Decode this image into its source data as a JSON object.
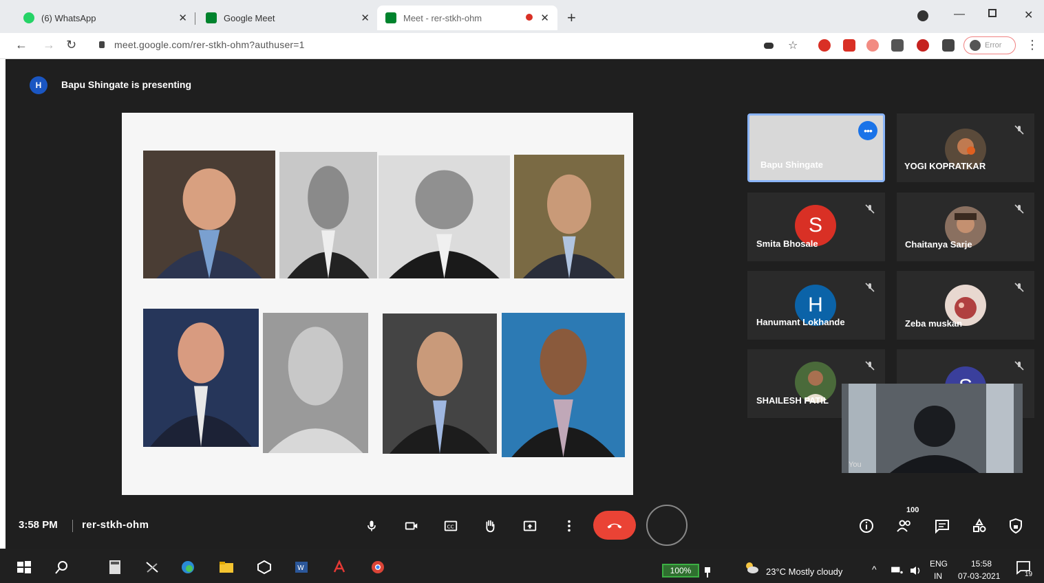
{
  "browser": {
    "tabs": [
      {
        "label": "(6) WhatsApp",
        "color": "#25d366",
        "active": false
      },
      {
        "label": "Google Meet",
        "color": "#00832d",
        "active": false
      },
      {
        "label": "Meet - rer-stkh-ohm",
        "color": "#00832d",
        "active": true
      }
    ],
    "new_tab": "+",
    "url": "meet.google.com/rer-stkh-ohm?authuser=1",
    "profile_label": "Error"
  },
  "meeting": {
    "presenter_initial": "H",
    "presenting_text": "Bapu Shingate is presenting",
    "time": "3:58 PM",
    "code": "rer-stkh-ohm",
    "participant_count": "100"
  },
  "participants": [
    {
      "name": "Bapu Shingate",
      "self_tile": true
    },
    {
      "name": "YOGI KOPRATKAR",
      "initial": "",
      "color": ""
    },
    {
      "name": "Smita Bhosale",
      "initial": "S",
      "color": "#d93025"
    },
    {
      "name": "Chaitanya Sarje",
      "initial": "",
      "color": ""
    },
    {
      "name": "Hanumant Lokhande",
      "initial": "H",
      "color": "#0b63a8"
    },
    {
      "name": "Zeba muskan",
      "initial": "",
      "color": ""
    },
    {
      "name": "SHAILESH PATIL",
      "initial": "",
      "color": ""
    },
    {
      "name": "",
      "initial": "S",
      "color": "#3a3f9c"
    }
  ],
  "selfview_label": "You",
  "controls": [
    "mic",
    "camera",
    "captions",
    "raise-hand",
    "present",
    "more",
    "hangup"
  ],
  "right_controls": [
    "info",
    "people",
    "chat",
    "activities",
    "host-controls"
  ],
  "taskbar": {
    "battery": "100%",
    "weather": "23°C  Mostly cloudy",
    "lang_top": "ENG",
    "lang_bottom": "IN",
    "time": "15:58",
    "date": "07-03-2021",
    "notifications": "19"
  }
}
